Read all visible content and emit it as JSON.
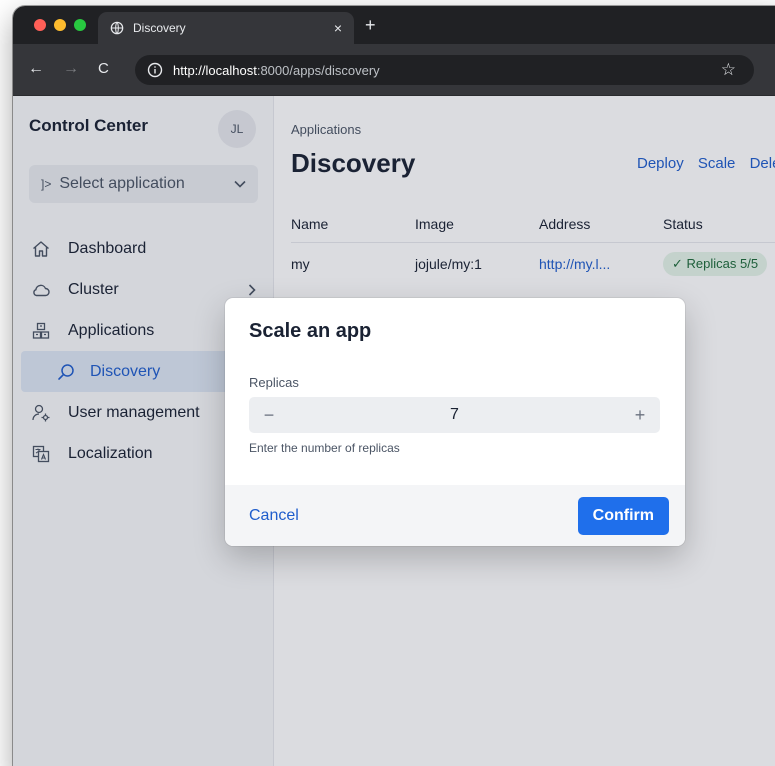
{
  "browser": {
    "tab_title": "Discovery",
    "tab_close": "×",
    "new_tab": "+",
    "url_host": "http://localhost",
    "url_path": ":8000/apps/discovery"
  },
  "sidebar": {
    "brand": "Control Center",
    "avatar_initials": "JL",
    "select_placeholder": "Select application",
    "items": [
      {
        "label": "Dashboard",
        "icon": "home-icon"
      },
      {
        "label": "Cluster",
        "icon": "cloud-icon"
      },
      {
        "label": "Applications",
        "icon": "applications-icon"
      },
      {
        "label": "Discovery",
        "icon": "search-icon"
      },
      {
        "label": "User management",
        "icon": "user-settings-icon"
      },
      {
        "label": "Localization",
        "icon": "translate-icon"
      }
    ]
  },
  "main": {
    "breadcrumb": "Applications",
    "title": "Discovery",
    "actions": [
      "Deploy",
      "Scale",
      "Delete"
    ],
    "table": {
      "headers": [
        "Name",
        "Image",
        "Address",
        "Status"
      ],
      "rows": [
        {
          "name": "my",
          "image": "jojule/my:1",
          "address": "http://my.l...",
          "status": "✓ Replicas 5/5"
        }
      ]
    }
  },
  "dialog": {
    "title": "Scale an app",
    "field_label": "Replicas",
    "value": "7",
    "decrement": "−",
    "increment": "+",
    "helper": "Enter the number of replicas",
    "cancel": "Cancel",
    "confirm": "Confirm"
  },
  "colors": {
    "accent": "#1f6feb",
    "link": "#1f5dcc",
    "badge_bg": "#e4f3e8",
    "badge_text": "#1e6b3a"
  }
}
